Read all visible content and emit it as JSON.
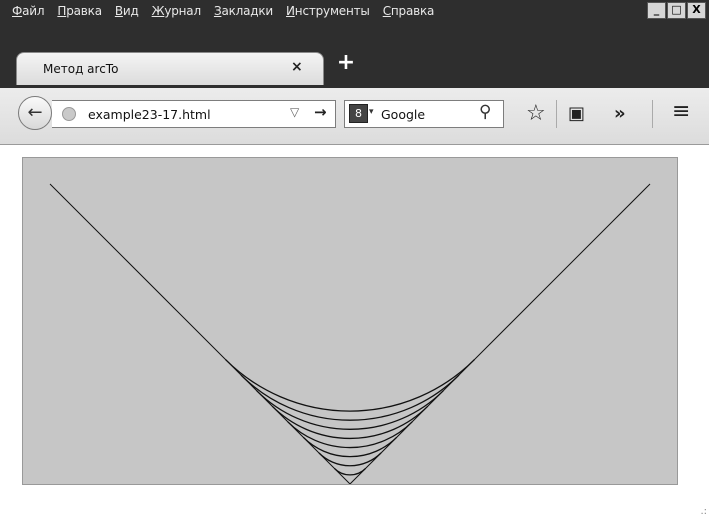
{
  "menu": {
    "items": [
      "Файл",
      "Правка",
      "Вид",
      "Журнал",
      "Закладки",
      "Инструменты",
      "Справка"
    ]
  },
  "window_controls": {
    "minimize": "_",
    "maximize": "□",
    "close": "X"
  },
  "tab": {
    "title": "Метод arcTo",
    "close": "×",
    "new_tab": "+"
  },
  "nav": {
    "back": "←",
    "url": "example23-17.html",
    "dropdown": "▽",
    "go": "→"
  },
  "search": {
    "engine": "8",
    "caret": "▾",
    "text": "Google",
    "icon": "⚲"
  },
  "toolbar": {
    "bookmark_star": "☆",
    "clipboard": "▣",
    "overflow": "»",
    "menu": "≡"
  },
  "canvas": {
    "background": "#c6c6c6",
    "stroke": "#111111"
  }
}
